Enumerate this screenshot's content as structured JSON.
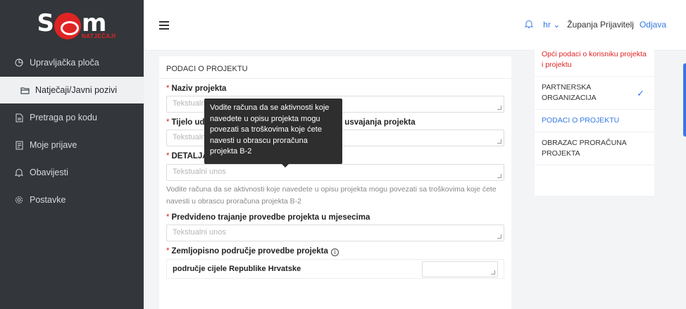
{
  "logo": {
    "text_left": "S",
    "text_right": "m",
    "subtitle": "NATJEČAJI"
  },
  "sidebar": {
    "items": [
      {
        "label": "Upravljačka ploča",
        "icon": "dashboard-icon"
      },
      {
        "label": "Natječaji/Javni pozivi",
        "icon": "folder-icon",
        "active": true
      },
      {
        "label": "Pretraga po kodu",
        "icon": "document-icon"
      },
      {
        "label": "Moje prijave",
        "icon": "file-icon"
      },
      {
        "label": "Obavijesti",
        "icon": "bell-icon"
      },
      {
        "label": "Postavke",
        "icon": "gear-icon"
      }
    ]
  },
  "header": {
    "language": "hr",
    "user": "Županja Prijavitelj",
    "logout": "Odjava"
  },
  "form": {
    "section_title": "PODACI O PROJEKTU",
    "fields": [
      {
        "label": "Naziv projekta",
        "placeholder": "Tekstualni unos"
      },
      {
        "label": "Tijelo udruge nadležno za usvajanje projekta i datum usvajanja projekta",
        "label_visible_start": "Tijelo udr",
        "label_visible_end": "tum usvajanja projekta",
        "placeholder": "Tekstualni unos"
      },
      {
        "label": "DETALJAN OPIS PROJEKTA",
        "placeholder": "Tekstualni unos",
        "hint": "Vodite računa da se aktivnosti koje navedete u opisu projekta mogu povezati sa troškovima koje ćete navesti u obrascu proračuna projekta B-2"
      },
      {
        "label": "Predviđeno trajanje provedbe projekta u mjesecima",
        "label_shown": "Predvideno trajanje provedbe projekta u mjesecima",
        "placeholder": "Tekstualni unos"
      },
      {
        "label": "Zemljopisno područje provedbe projekta"
      }
    ],
    "region_row_label": "područje cijele Republike Hrvatske"
  },
  "tooltip": {
    "text": "Vodite računa da se aktivnosti koje navedete u opisu projekta mogu povezati sa troškovima koje ćete navesti u obrascu proračuna projekta B-2"
  },
  "steps": [
    {
      "label": "Opći podaci o korisniku projekta i projektu",
      "state": "red"
    },
    {
      "label": "PARTNERSKA ORGANIZACIJA",
      "state": "done"
    },
    {
      "label": "PODACI O PROJEKTU",
      "state": "current"
    },
    {
      "label": "OBRAZAC PRORAČUNA PROJEKTA",
      "state": "plain"
    }
  ],
  "colors": {
    "accent": "#3578e5",
    "brand_red": "#e02424",
    "sidebar_bg": "#33363a"
  }
}
